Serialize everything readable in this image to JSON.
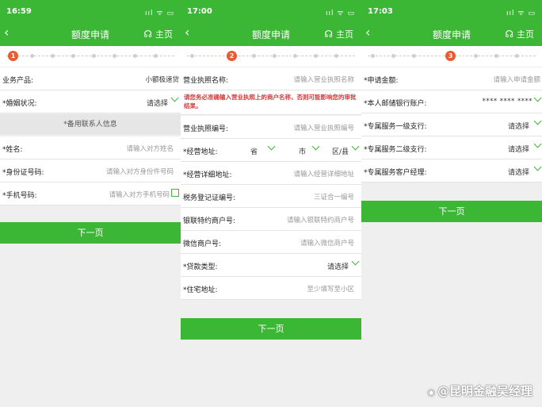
{
  "screens": [
    {
      "status": {
        "time": "16:59",
        "icons": "ııl ᯤ ▭"
      },
      "nav": {
        "back": "‹",
        "title": "额度申请",
        "home": "主页",
        "home_icon": "headset-icon"
      },
      "step": {
        "current": "1",
        "total": 8
      },
      "form": {
        "product_label": "业务产品:",
        "product_value": "小额极速贷",
        "marital_label": "*婚姻状况:",
        "marital_select": "请选择",
        "section_title": "*备用联系人信息",
        "name_label": "*姓名:",
        "name_placeholder": "请输入对方姓名",
        "id_label": "*身份证号码:",
        "id_placeholder": "请输入对方身份件号码",
        "phone_label": "*手机号码:",
        "phone_placeholder": "请输入对方手机号码"
      },
      "next_button": "下一页"
    },
    {
      "status": {
        "time": "17:00",
        "icons": "ııl ᯤ ▭"
      },
      "nav": {
        "back": "‹",
        "title": "额度申请",
        "home": "主页",
        "home_icon": "headset-icon"
      },
      "step": {
        "current": "2",
        "total": 8
      },
      "form": {
        "license_name_label": "营业执照名称:",
        "license_name_placeholder": "请输入营业执照名称",
        "warning": "请您务必准确输入营业执照上的商户名称，否则可能影响您的审批结果。",
        "license_no_label": "营业执照编号:",
        "license_no_placeholder": "请输入营业执照编号",
        "address_label": "*经营地址:",
        "province": "省",
        "city": "市",
        "district": "区/县",
        "address_detail_label": "*经营详细地址:",
        "address_detail_placeholder": "请输入经营详细地址",
        "tax_label": "税务登记证编号:",
        "tax_placeholder": "三证合一编号",
        "unionpay_label": "银联特约商户号:",
        "unionpay_placeholder": "请输入银联特约商户号",
        "wechat_label": "微信商户号:",
        "wechat_placeholder": "请输入微信商户号",
        "loan_type_label": "*贷款类型:",
        "loan_type_select": "请选择",
        "home_addr_label": "*住宅地址:",
        "home_addr_placeholder": "至少填写至小区"
      },
      "next_button": "下一页"
    },
    {
      "status": {
        "time": "17:03",
        "icons": "ııl ᯤ ▭"
      },
      "nav": {
        "back": "‹",
        "title": "额度申请",
        "home": "主页",
        "home_icon": "headset-icon"
      },
      "step": {
        "current": "3",
        "total": 8
      },
      "form": {
        "amount_label": "*申请金额:",
        "amount_placeholder": "请输入申请金额",
        "account_label": "*本人邮储银行账户:",
        "account_value": "**** **** ****",
        "branch1_label": "*专属服务一级支行:",
        "branch1_select": "请选择",
        "branch2_label": "*专属服务二级支行:",
        "branch2_select": "请选择",
        "manager_label": "*专属服务客户经理:",
        "manager_select": "请选择"
      },
      "next_button": "下一页"
    }
  ],
  "watermark": {
    "text": "@昆明金融吴经理",
    "logo": "weibo-logo-icon"
  },
  "colors": {
    "brand_green": "#3cb635",
    "step_orange": "#e85d2f",
    "warning_red": "#d23c3c"
  }
}
